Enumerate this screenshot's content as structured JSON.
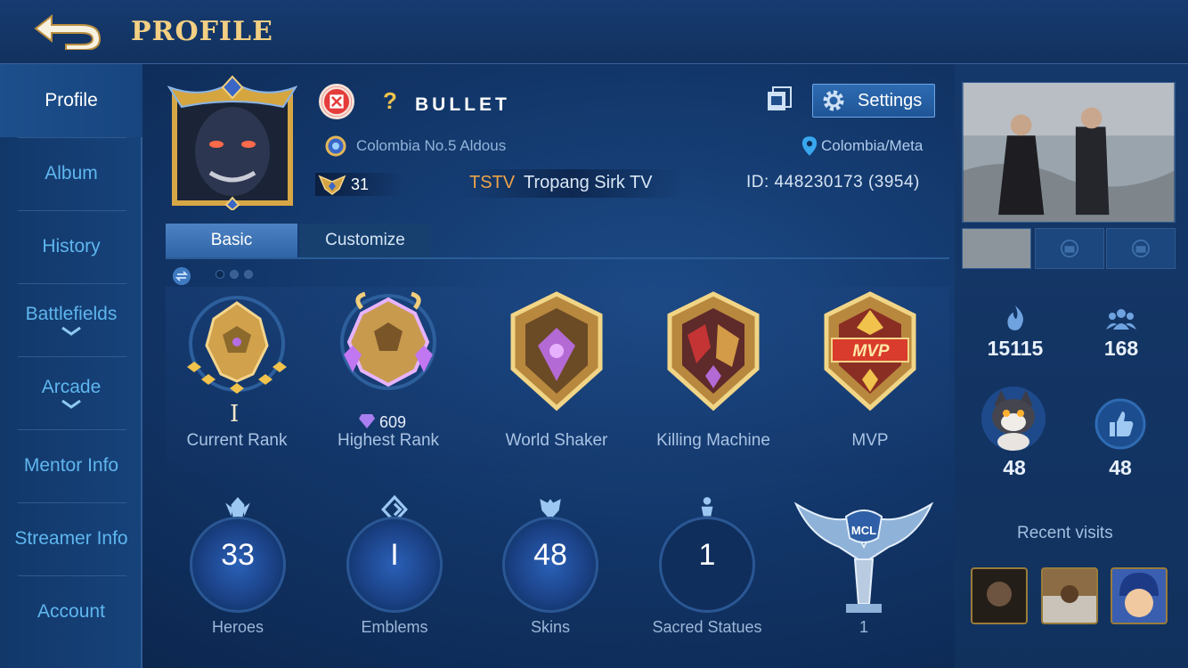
{
  "header": {
    "title": "PROFILE"
  },
  "sidebar": {
    "items": [
      {
        "label": "Profile"
      },
      {
        "label": "Album"
      },
      {
        "label": "History"
      },
      {
        "label": "Battlefields"
      },
      {
        "label": "Arcade"
      },
      {
        "label": "Mentor Info"
      },
      {
        "label": "Streamer Info"
      },
      {
        "label": "Account"
      }
    ]
  },
  "player": {
    "name": "BULLET",
    "unknown_badge": "?",
    "title": "Colombia No.5 Aldous",
    "region": "Colombia/Meta",
    "level": "31",
    "squad_tag": "TSTV",
    "squad_name": "Tropang Sirk TV",
    "id_text": "ID:  448230173 (3954)"
  },
  "settings_label": "Settings",
  "tabs": {
    "basic": "Basic",
    "customize": "Customize"
  },
  "achievements": [
    {
      "label": "Current Rank",
      "value": "I"
    },
    {
      "label": "Highest Rank",
      "value": "609"
    },
    {
      "label": "World Shaker"
    },
    {
      "label": "Killing Machine"
    },
    {
      "label": "MVP",
      "badge_text": "MVP"
    }
  ],
  "stats": [
    {
      "label": "Heroes",
      "value": "33"
    },
    {
      "label": "Emblems",
      "value": "I"
    },
    {
      "label": "Skins",
      "value": "48"
    },
    {
      "label": "Sacred Statues",
      "value": "1"
    },
    {
      "label": "1",
      "badge_text": "MCL"
    }
  ],
  "right_panel": {
    "popularity": "15115",
    "followers": "168",
    "pet_count": "48",
    "likes": "48",
    "recent_visits_label": "Recent visits"
  },
  "colors": {
    "accent_gold": "#f3cf83",
    "link_blue": "#5fb6ee",
    "squad_orange": "#f0a449"
  },
  "icons": [
    "back-arrow-icon",
    "x-badge-icon",
    "copy-icon",
    "gear-icon",
    "location-pin-icon",
    "level-badge-icon",
    "swap-icon",
    "fire-icon",
    "group-icon",
    "thumbs-up-icon",
    "camera-icon"
  ]
}
